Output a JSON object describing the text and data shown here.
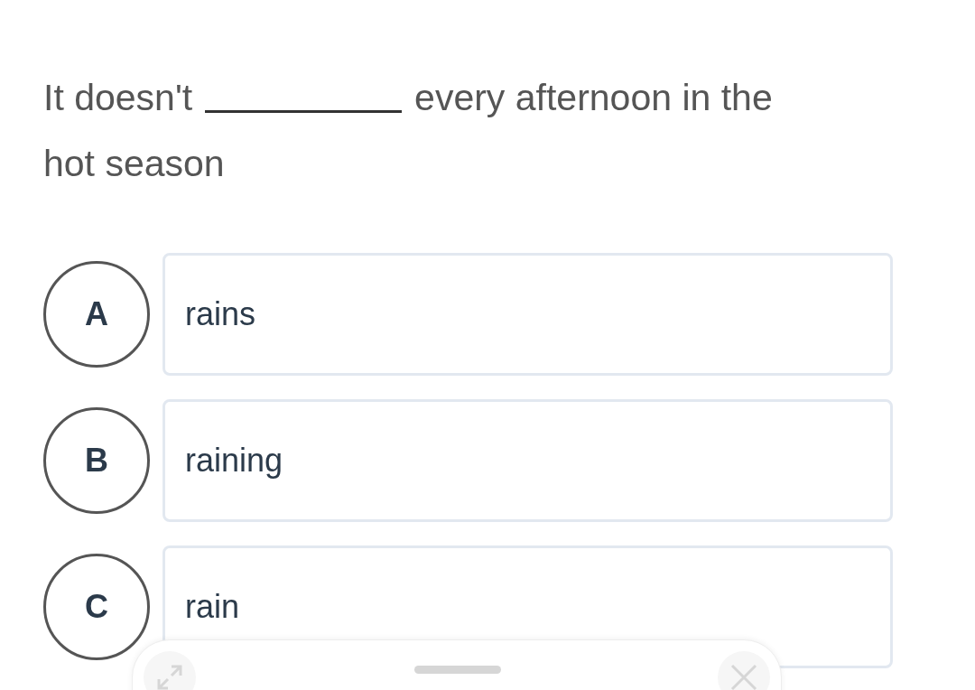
{
  "question": {
    "before": "It doesn't",
    "after_lines": [
      "every afternoon in the",
      "hot season"
    ]
  },
  "options": [
    {
      "letter": "A",
      "text": "rains",
      "selected": false
    },
    {
      "letter": "B",
      "text": "raining",
      "selected": false
    },
    {
      "letter": "C",
      "text": "rain",
      "selected": false
    }
  ]
}
